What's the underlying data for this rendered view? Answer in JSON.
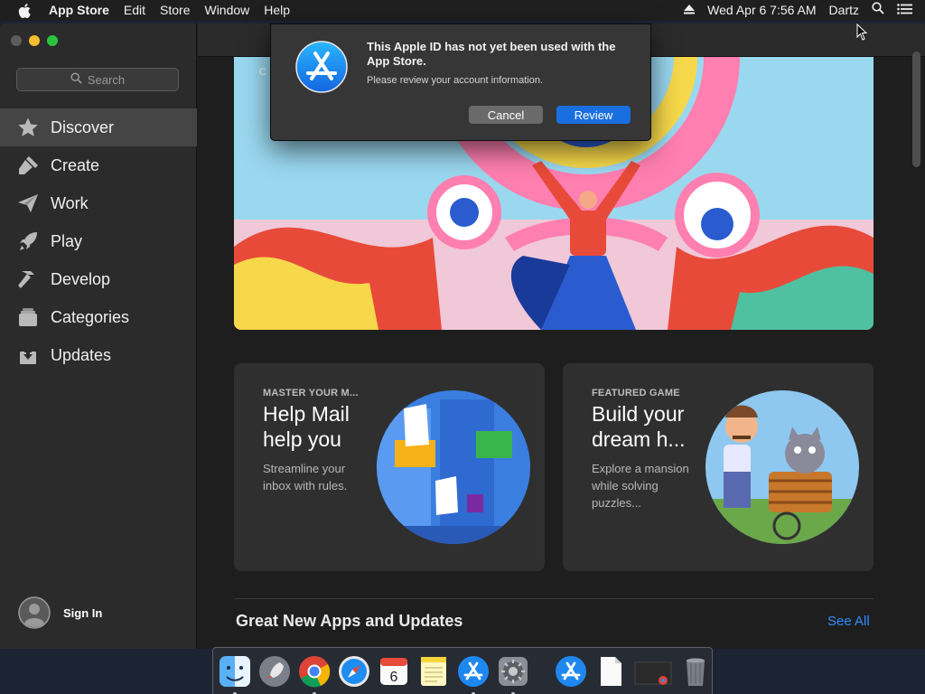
{
  "menubar": {
    "app_name": "App Store",
    "menus": [
      "Edit",
      "Store",
      "Window",
      "Help"
    ],
    "datetime": "Wed Apr 6  7:56 AM",
    "user": "Dartz"
  },
  "sidebar": {
    "search_placeholder": "Search",
    "items": [
      {
        "label": "Discover",
        "icon": "star-icon",
        "active": true
      },
      {
        "label": "Create",
        "icon": "brush-icon"
      },
      {
        "label": "Work",
        "icon": "paper-plane-icon"
      },
      {
        "label": "Play",
        "icon": "rocket-icon"
      },
      {
        "label": "Develop",
        "icon": "hammer-icon"
      },
      {
        "label": "Categories",
        "icon": "stack-icon"
      },
      {
        "label": "Updates",
        "icon": "download-icon"
      }
    ],
    "sign_in": "Sign In"
  },
  "dialog": {
    "heading": "This Apple ID has not yet been used with the App Store.",
    "message": "Please review your account information.",
    "cancel": "Cancel",
    "review": "Review"
  },
  "cards": [
    {
      "eyebrow": "MASTER YOUR M...",
      "title": "Help Mail help you",
      "desc": "Streamline your inbox with rules."
    },
    {
      "eyebrow": "FEATURED GAME",
      "title": "Build your dream h...",
      "desc": "Explore a mansion while solving puzzles..."
    }
  ],
  "section": {
    "title": "Great New Apps and Updates",
    "see_all": "See All"
  },
  "colors": {
    "accent": "#1a6fe0",
    "link": "#2f8cff"
  }
}
